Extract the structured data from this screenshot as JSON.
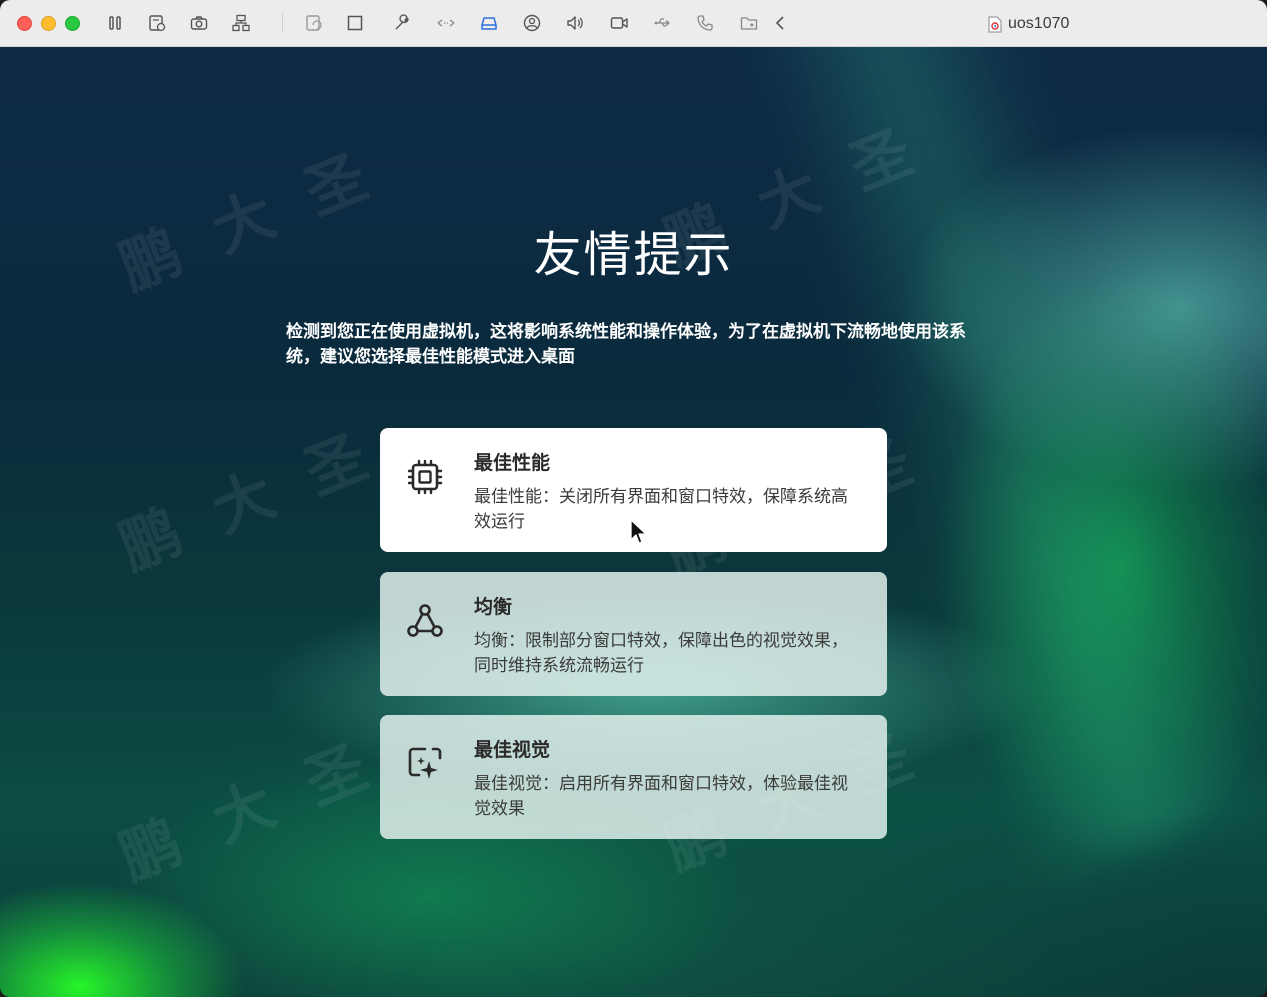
{
  "window": {
    "title": "uos1070"
  },
  "toolbar": {
    "icons": [
      "pause-icon",
      "snapshot-settings-icon",
      "camera-icon",
      "network-icon",
      "restore-icon",
      "fullscreen-icon",
      "wrench-icon",
      "resize-icon",
      "drive-icon",
      "user-icon",
      "speaker-icon",
      "video-icon",
      "usb-icon",
      "phone-icon",
      "shared-folder-icon",
      "chevron-left-icon"
    ]
  },
  "desktop": {
    "heading": "友情提示",
    "notice": "检测到您正在使用虚拟机，这将影响系统性能和操作体验，为了在虚拟机下流畅地使用该系统，建议您选择最佳性能模式进入桌面",
    "watermark": "鹏大圣",
    "options": [
      {
        "title": "最佳性能",
        "description": "最佳性能：关闭所有界面和窗口特效，保障系统高效运行",
        "icon": "chip-icon",
        "selected": true
      },
      {
        "title": "均衡",
        "description": "均衡：限制部分窗口特效，保障出色的视觉效果，同时维持系统流畅运行",
        "icon": "balance-nodes-icon",
        "selected": false
      },
      {
        "title": "最佳视觉",
        "description": "最佳视觉：启用所有界面和窗口特效，体验最佳视觉效果",
        "icon": "sparkle-icon",
        "selected": false
      }
    ]
  },
  "colors": {
    "titlebar": "#ececec",
    "card_active": "#ffffff",
    "card_inactive": "#e1f0ec",
    "text_primary": "#2a2a2a"
  }
}
